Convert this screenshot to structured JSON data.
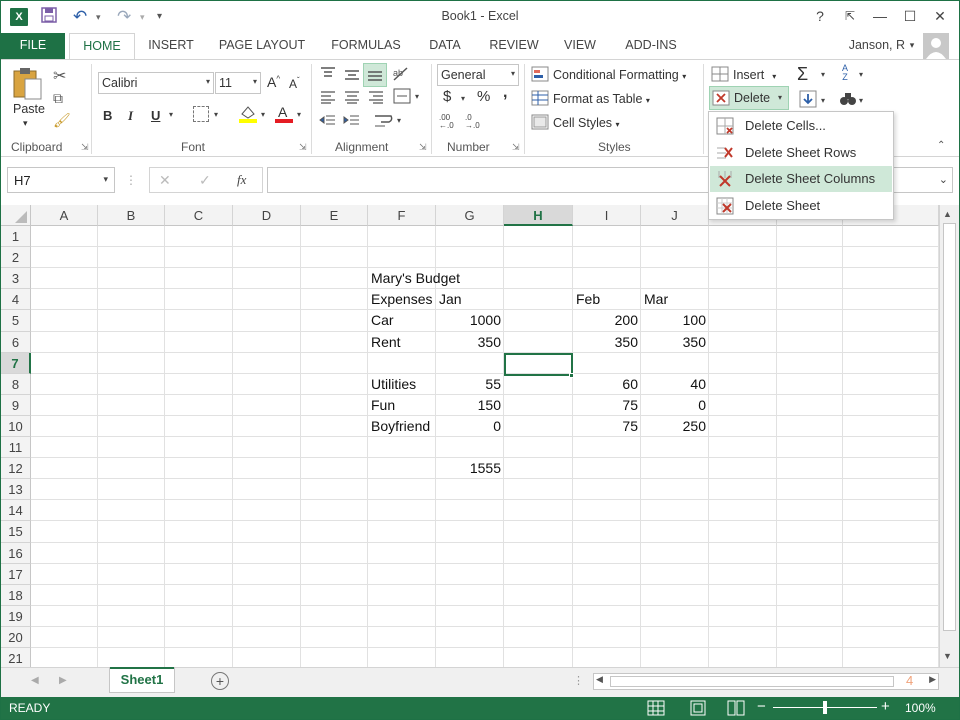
{
  "window": {
    "title": "Book1 - Excel",
    "help": "?",
    "restore": "⧉",
    "minimize": "—",
    "maximize": "☐",
    "close": "✕"
  },
  "qat": {
    "app_icon": "X",
    "save": "💾",
    "undo": "↶",
    "undo_dd": "▾",
    "redo": "↷",
    "redo_dd": "▾",
    "customize": "₹"
  },
  "tabs": [
    "FILE",
    "HOME",
    "INSERT",
    "PAGE LAYOUT",
    "FORMULAS",
    "DATA",
    "REVIEW",
    "VIEW",
    "ADD-INS"
  ],
  "user": {
    "name": "Janson, R",
    "dd": "▾"
  },
  "ribbon": {
    "clipboard": {
      "label": "Clipboard",
      "paste": "Paste"
    },
    "font": {
      "label": "Font",
      "name": "Calibri",
      "size": "11",
      "bold": "B",
      "italic": "I",
      "underline": "U",
      "grow": "A",
      "shrink": "A"
    },
    "alignment": {
      "label": "Alignment"
    },
    "number": {
      "label": "Number",
      "format": "General",
      "currency": "$",
      "percent": "%",
      "comma": ",",
      "inc_dec": ".00",
      "dec_dec": ".0"
    },
    "styles": {
      "label": "Styles",
      "conditional": "Conditional Formatting",
      "format_table": "Format as Table",
      "cell_styles": "Cell Styles"
    },
    "cells": {
      "insert": "Insert",
      "delete": "Delete"
    },
    "editing": {
      "sum": "Σ",
      "sort": "A Z",
      "find": "🔭"
    }
  },
  "formula_bar": {
    "name_box": "H7",
    "cancel": "✕",
    "enter": "✓",
    "fx": "fx",
    "content": ""
  },
  "columns": [
    "A",
    "B",
    "C",
    "D",
    "E",
    "F",
    "G",
    "H",
    "I",
    "J"
  ],
  "rows": [
    "1",
    "2",
    "3",
    "4",
    "5",
    "6",
    "7",
    "8",
    "9",
    "10",
    "11",
    "12",
    "13",
    "14",
    "15",
    "16",
    "17",
    "18",
    "19",
    "20",
    "21"
  ],
  "cells": {
    "F3": "Mary's Budget",
    "F4": "Expenses",
    "G4": "Jan",
    "I4": "Feb",
    "J4": "Mar",
    "F5": "Car",
    "G5": "1000",
    "I5": "200",
    "J5": "100",
    "F6": "Rent",
    "G6": "350",
    "I6": "350",
    "J6": "350",
    "F8": "Utilities",
    "G8": "55",
    "I8": "60",
    "J8": "40",
    "F9": "Fun",
    "G9": "150",
    "I9": "75",
    "J9": "0",
    "F10": "Boyfriend",
    "G10": "0",
    "I10": "75",
    "J10": "250",
    "G12": "1555"
  },
  "delete_menu": [
    "Delete Cells...",
    "Delete Sheet Rows",
    "Delete Sheet Columns",
    "Delete Sheet"
  ],
  "sheet_tabs": {
    "active": "Sheet1",
    "add": "+",
    "page_num": "4"
  },
  "status": {
    "mode": "READY",
    "zoom": "100%",
    "zoom_minus": "−",
    "zoom_plus": "+"
  },
  "colors": {
    "accent": "#1e7145",
    "status_bg": "#217346",
    "highlight": "#cfe8d8"
  }
}
